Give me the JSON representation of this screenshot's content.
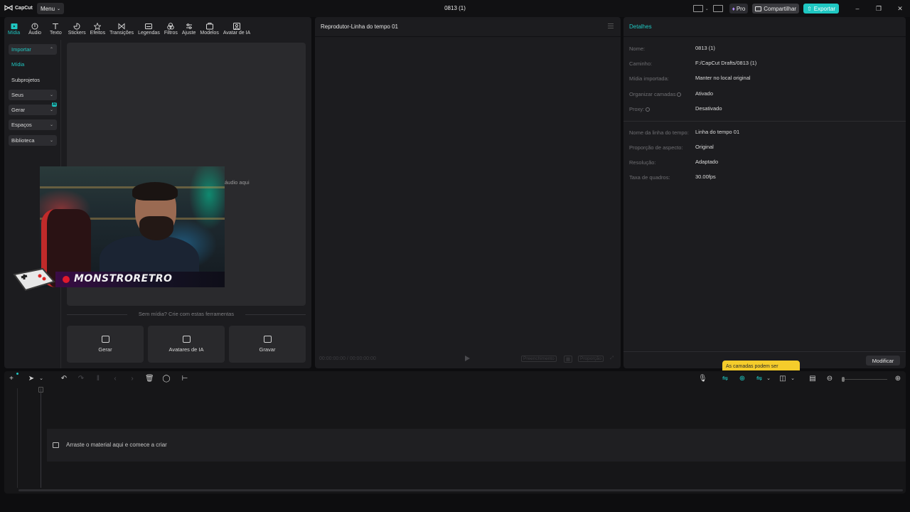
{
  "app": {
    "logo_text": "CapCut",
    "menu_label": "Menu",
    "document_title": "0813 (1)",
    "pro_label": "Pro",
    "share_label": "Compartilhar",
    "export_label": "Exportar"
  },
  "tool_tabs": [
    {
      "label": "Mídia",
      "icon": "media-icon",
      "active": true
    },
    {
      "label": "Áudio",
      "icon": "audio-icon"
    },
    {
      "label": "Texto",
      "icon": "text-icon"
    },
    {
      "label": "Stickers",
      "icon": "sticker-icon"
    },
    {
      "label": "Efeitos",
      "icon": "effects-icon"
    },
    {
      "label": "Transições",
      "icon": "transitions-icon"
    },
    {
      "label": "Legendas",
      "icon": "captions-icon"
    },
    {
      "label": "Filtros",
      "icon": "filters-icon"
    },
    {
      "label": "Ajuste",
      "icon": "adjust-icon"
    },
    {
      "label": "Modelos",
      "icon": "templates-icon"
    },
    {
      "label": "Avatar de IA",
      "icon": "ai-avatar-icon"
    }
  ],
  "sidebar": {
    "items": [
      {
        "label": "Importar",
        "expanded": true
      },
      {
        "label": "Mídia",
        "active": true
      },
      {
        "label": "Subprojetos"
      },
      {
        "label": "Seus"
      },
      {
        "label": "Gerar",
        "badge": "AI"
      },
      {
        "label": "Espaços"
      },
      {
        "label": "Biblioteca"
      }
    ]
  },
  "media": {
    "drop_hint": "áudio aqui",
    "no_media_text": "Sem mídia? Crie com estas ferramentas",
    "tools": [
      {
        "label": "Gerar",
        "icon": "generate-icon"
      },
      {
        "label": "Avatares de IA",
        "icon": "ai-avatars-icon"
      },
      {
        "label": "Gravar",
        "icon": "record-icon"
      }
    ]
  },
  "webcam": {
    "banner_text": "MONSTRORETRO"
  },
  "player": {
    "title": "Reprodutor-Linha do tempo 01",
    "timecode": "00:00:00:00 / 00:00:00:00",
    "ctrl_full": "Preenchimento",
    "ctrl_ratio": "Proporção"
  },
  "details": {
    "title": "Detalhes",
    "rows_project": [
      {
        "label": "Nome:",
        "value": "0813 (1)"
      },
      {
        "label": "Caminho:",
        "value": "F:/CapCut Drafts/0813 (1)"
      },
      {
        "label": "Mídia importada:",
        "value": "Manter no local original"
      },
      {
        "label": "Organizar camadas",
        "value": "Ativado",
        "info": true
      },
      {
        "label": "Proxy:",
        "value": "Desativado",
        "info": true
      }
    ],
    "rows_timeline": [
      {
        "label": "Nome da linha do tempo:",
        "value": "Linha do tempo 01"
      },
      {
        "label": "Proporção de aspecto:",
        "value": "Original"
      },
      {
        "label": "Resolução:",
        "value": "Adaptado"
      },
      {
        "label": "Taxa de quadros:",
        "value": "30.00fps"
      }
    ],
    "modify_label": "Modificar",
    "tooltip_text": "As camadas podem ser"
  },
  "timeline": {
    "track_hint": "Arraste o material aqui e comece a criar"
  },
  "colors": {
    "accent": "#1fc7c2",
    "tooltip": "#f5cc2b"
  }
}
